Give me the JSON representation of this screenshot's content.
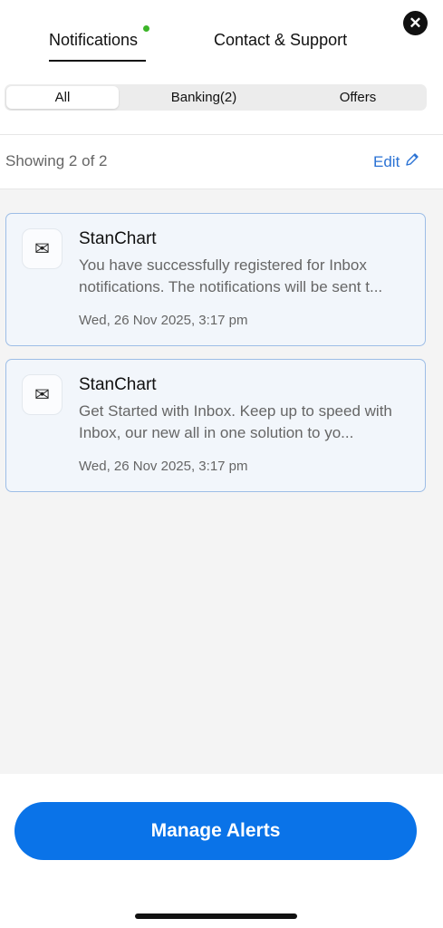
{
  "header": {
    "tabs": [
      {
        "label": "Notifications",
        "active": true
      },
      {
        "label": "Contact & Support",
        "active": false
      }
    ],
    "close_icon": "close-icon",
    "new_indicator_color": "#3cb528"
  },
  "filters": {
    "segments": [
      {
        "label": "All",
        "selected": true
      },
      {
        "label": "Banking(2)",
        "selected": false
      },
      {
        "label": "Offers",
        "selected": false
      }
    ]
  },
  "list_header": {
    "showing": "Showing 2 of 2",
    "edit_label": "Edit",
    "edit_icon": "pencil-icon",
    "accent_color": "#2a72d4"
  },
  "notifications": [
    {
      "icon": "envelope-icon",
      "sender": "StanChart",
      "message": "You have successfully registered for Inbox notifications. The notifications will be sent t...",
      "timestamp": "Wed, 26 Nov 2025, 3:17 pm"
    },
    {
      "icon": "envelope-icon",
      "sender": "StanChart",
      "message": "Get Started with Inbox. Keep up to speed with Inbox, our new all in one solution to yo...",
      "timestamp": "Wed, 26 Nov 2025, 3:17 pm"
    }
  ],
  "footer": {
    "manage_label": "Manage Alerts",
    "button_color": "#0a73e8"
  }
}
